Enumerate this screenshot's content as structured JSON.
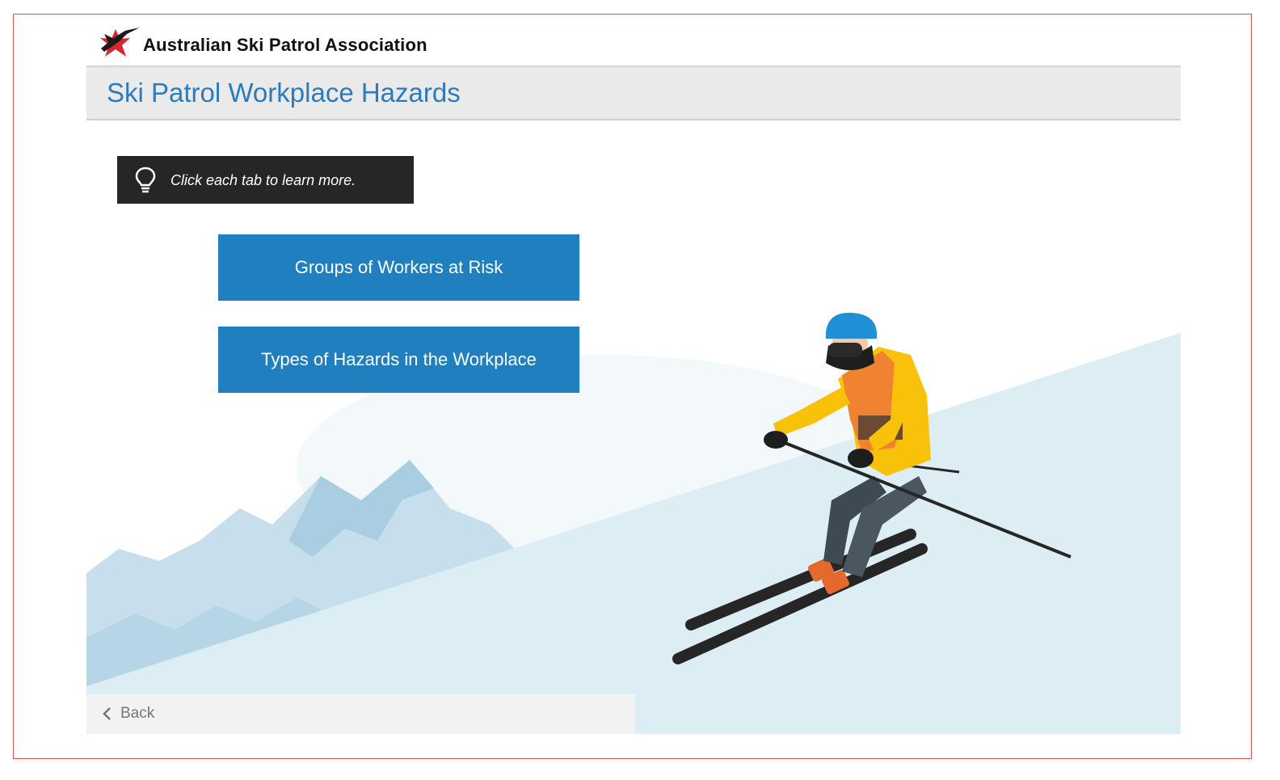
{
  "header": {
    "brand_name": "Australian Ski Patrol Association",
    "logo_icon": "aspa-star-logo-icon"
  },
  "page": {
    "title": "Ski Patrol Workplace Hazards"
  },
  "tip": {
    "icon": "lightbulb-icon",
    "text": "Click each tab to learn more."
  },
  "tabs": [
    {
      "label": "Groups of Workers at Risk"
    },
    {
      "label": "Types of Hazards in the Workplace"
    }
  ],
  "footer": {
    "back_label": "Back",
    "back_icon": "chevron-left-icon"
  },
  "colors": {
    "accent": "#1f7fbf",
    "title": "#2b7bbd",
    "tip_bg": "#262626",
    "slope": "#dcedf4"
  }
}
